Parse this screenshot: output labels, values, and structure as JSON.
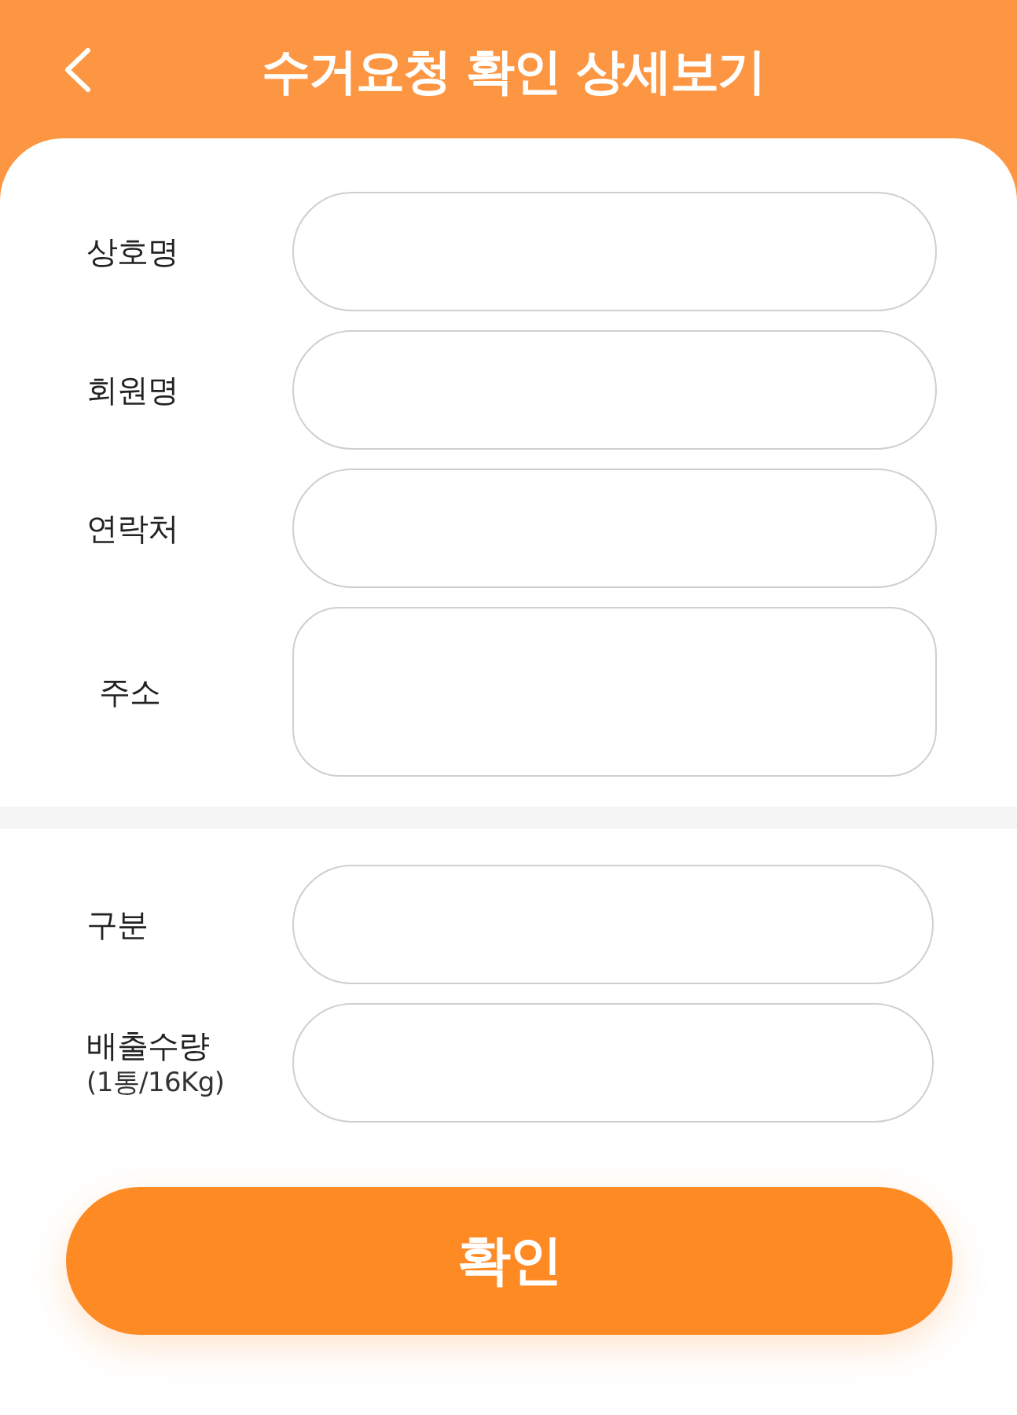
{
  "header": {
    "title": "수거요청 확인 상세보기"
  },
  "sections": [
    {
      "fields": [
        {
          "label": "상호명",
          "kind": "line"
        },
        {
          "label": "회원명",
          "kind": "line"
        },
        {
          "label": "연락처",
          "kind": "line"
        },
        {
          "label": "주소",
          "kind": "area"
        }
      ]
    },
    {
      "fields": [
        {
          "label": "구분",
          "kind": "line"
        },
        {
          "label": "배출수량",
          "note": "(1통/16Kg)",
          "kind": "line"
        }
      ]
    }
  ],
  "confirm_button": {
    "label": "확인"
  }
}
